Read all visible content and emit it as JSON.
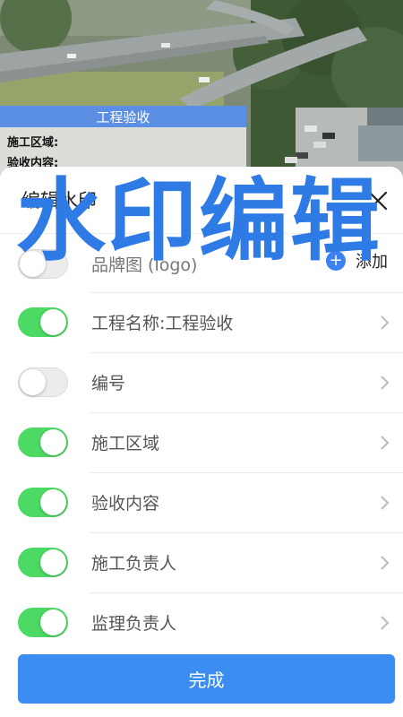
{
  "watermark_preview": {
    "title": "工程验收",
    "lines": [
      "施工区域:",
      "验收内容:"
    ]
  },
  "sheet": {
    "title": "编辑水印",
    "overlay_title": "水印编辑",
    "add_label": "添加",
    "items": [
      {
        "label": "品牌图 (logo)",
        "enabled": false
      },
      {
        "label": "工程名称:工程验收",
        "enabled": true
      },
      {
        "label": "编号",
        "enabled": false
      },
      {
        "label": "施工区域",
        "enabled": true
      },
      {
        "label": "验收内容",
        "enabled": true
      },
      {
        "label": "施工负责人",
        "enabled": true
      },
      {
        "label": "监理负责人",
        "enabled": true
      }
    ],
    "done_label": "完成"
  },
  "colors": {
    "accent": "#3b8df2",
    "toggle_on": "#4cd964",
    "watermark_header": "#5b8fe3"
  }
}
